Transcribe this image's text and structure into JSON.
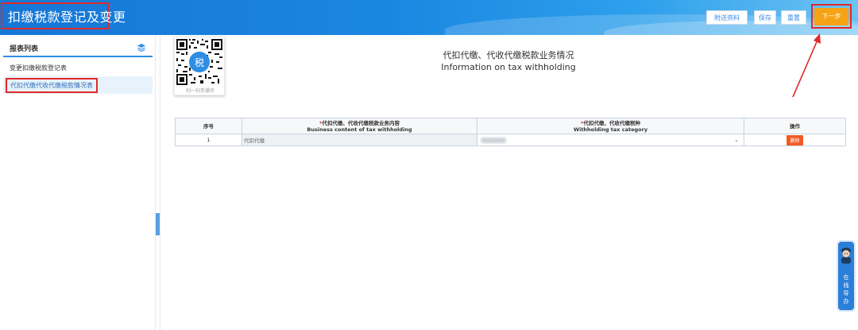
{
  "header": {
    "title": "扣缴税款登记及变更",
    "buttons": {
      "attach": "附送资料",
      "save": "保存",
      "reset": "重置",
      "next": "下一步"
    }
  },
  "sidebar": {
    "heading": "报表列表",
    "items": [
      {
        "label": "变更扣缴税款登记表"
      },
      {
        "label": "代扣代缴代收代缴税款情况表"
      }
    ]
  },
  "qr": {
    "caption": "扫一扫手操作"
  },
  "page": {
    "title_cn": "代扣代缴、代收代缴税款业务情况",
    "title_en": "Information on tax withholding"
  },
  "table": {
    "headers": {
      "index": "序号",
      "content_cn": "代扣代缴、代收代缴税款业务内容",
      "content_en": "Business content of tax withholding",
      "category_cn": "代扣代缴、代收代缴税种",
      "category_en": "Withholding tax category",
      "op": "操作"
    },
    "required_mark": "*",
    "rows": [
      {
        "index": "1",
        "content": "代扣代缴",
        "delete": "删除"
      }
    ]
  },
  "help": {
    "label": "在线导办"
  }
}
